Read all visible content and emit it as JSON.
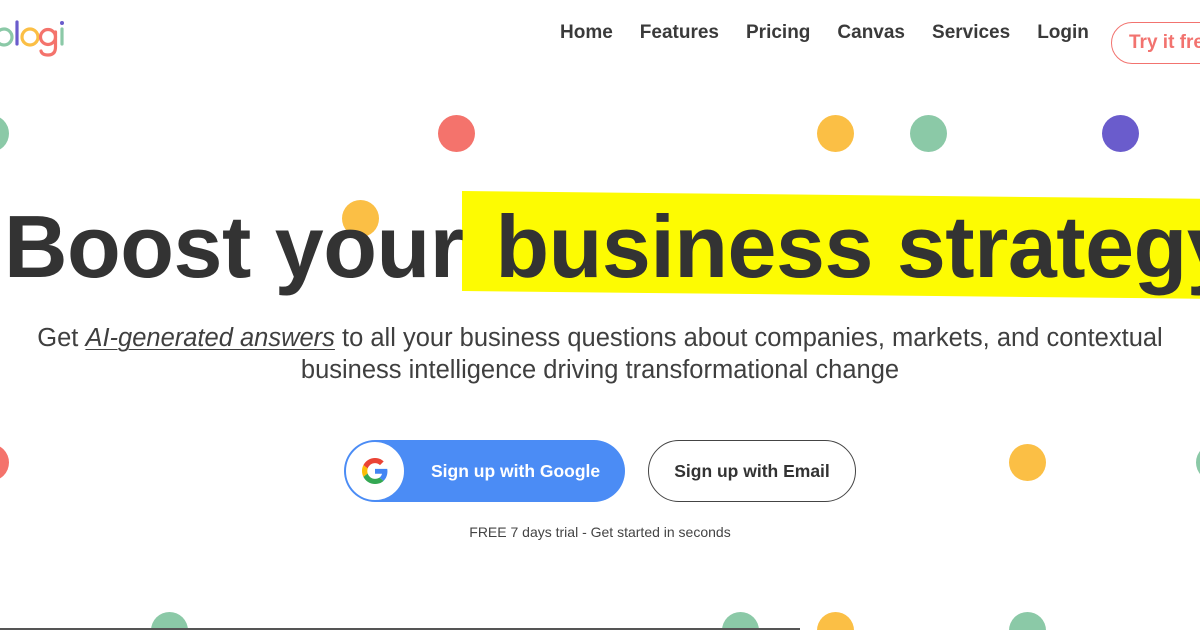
{
  "brand": {
    "logo_text": "logi",
    "logo_colors": [
      "#f4736c",
      "#fbbf45",
      "#8bc9a7",
      "#6a5ccc"
    ]
  },
  "nav": {
    "items": [
      {
        "label": "Home"
      },
      {
        "label": "Features"
      },
      {
        "label": "Pricing"
      },
      {
        "label": "Canvas"
      },
      {
        "label": "Services"
      },
      {
        "label": "Login"
      }
    ],
    "cta_label": "Try it free",
    "cta_color": "#f2736f"
  },
  "hero": {
    "title_plain": "Boost your",
    "title_highlight": "business strategy",
    "highlight_color": "#fdfb02",
    "subtitle_before": "Get ",
    "subtitle_emphasis": "AI-generated answers",
    "subtitle_after": " to all your business questions about companies, markets, and contextual business intelligence driving transformational change"
  },
  "cta": {
    "google_label": "Sign up with Google",
    "google_color": "#4b8cf5",
    "email_label": "Sign up with Email",
    "trial_note": "FREE 7 days trial - Get started in seconds"
  },
  "icons": {
    "google": "google-g-icon"
  },
  "palette": {
    "red": "#f4736c",
    "yellow": "#fbbf45",
    "green": "#8bc9a7",
    "purple": "#6a5ccc"
  }
}
